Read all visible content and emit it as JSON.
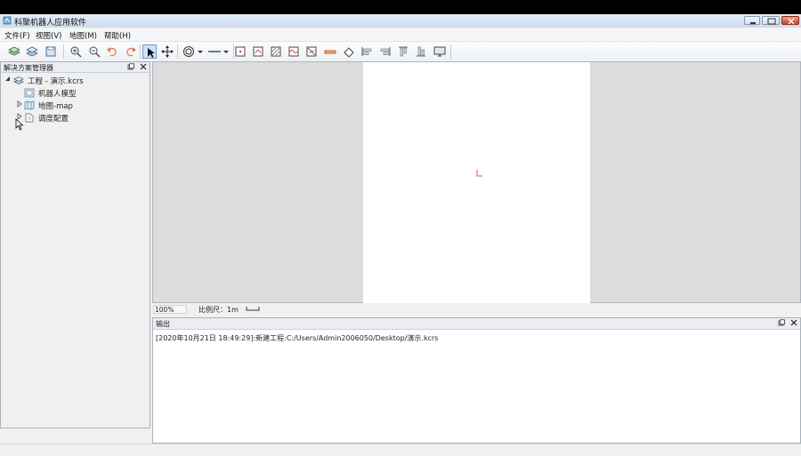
{
  "window": {
    "title": "科聚机器人应用软件"
  },
  "menu": [
    {
      "label": "文件(F)"
    },
    {
      "label": "视图(V)"
    },
    {
      "label": "地图(M)"
    },
    {
      "label": "帮助(H)"
    }
  ],
  "toolbar": {
    "icons": [
      "layers-add-icon",
      "layers-icon",
      "save-icon",
      "zoom-in-icon",
      "zoom-out-icon",
      "undo-icon",
      "redo-icon",
      "select-pointer-icon",
      "move-icon",
      "circle-target-icon",
      "line-style-icon",
      "rect-point-icon",
      "rect-curve-icon",
      "hatch-rect-icon",
      "wave-rect-icon",
      "cross-rect-icon",
      "bar-icon",
      "eraser-icon",
      "align-left-icon",
      "align-right-icon",
      "align-top-icon",
      "align-bottom-icon",
      "monitor-icon"
    ]
  },
  "explorer": {
    "title": "解决方案管理器",
    "root": {
      "label": "工程 - 演示.kcrs"
    },
    "items": [
      {
        "label": "机器人模型"
      },
      {
        "label": "地图-map"
      },
      {
        "label": "调度配置"
      }
    ]
  },
  "mapview": {
    "zoom": "100%",
    "scale_label": "比例尺：1m"
  },
  "output": {
    "title": "输出",
    "log": "[2020年10月21日 18:49:29]:新建工程:C:/Users/Admin2006050/Desktop/演示.kcrs"
  },
  "colors": {
    "titlebar": "#cfdcec",
    "close_button": "#c3452b",
    "accent": "#6e9ccb",
    "map_marker": "#e0554b"
  }
}
